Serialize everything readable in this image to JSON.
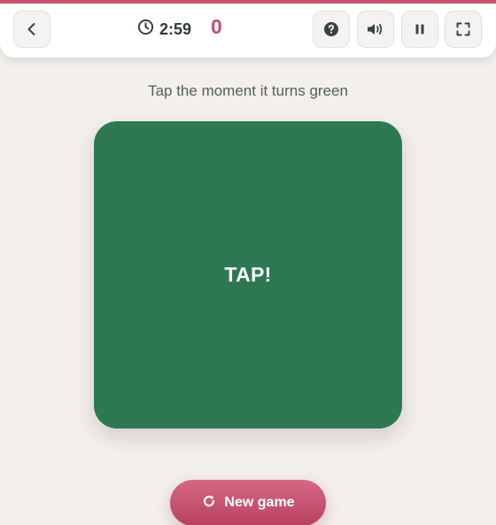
{
  "header": {
    "timer": "2:59",
    "score": "0",
    "icons": {
      "back": "chevron-left-icon",
      "timer": "clock-icon",
      "help": "question-circle-icon",
      "sound": "volume-icon",
      "pause": "pause-icon",
      "fullscreen": "fullscreen-icon"
    }
  },
  "game": {
    "instruction": "Tap the moment it turns green",
    "tap_label": "TAP!",
    "state_color": "#2e7851"
  },
  "controls": {
    "new_game_label": "New game",
    "new_game_icon": "restart-icon"
  },
  "colors": {
    "accent": "#c9506e",
    "score": "#c24f6f",
    "background": "#f2efec"
  }
}
